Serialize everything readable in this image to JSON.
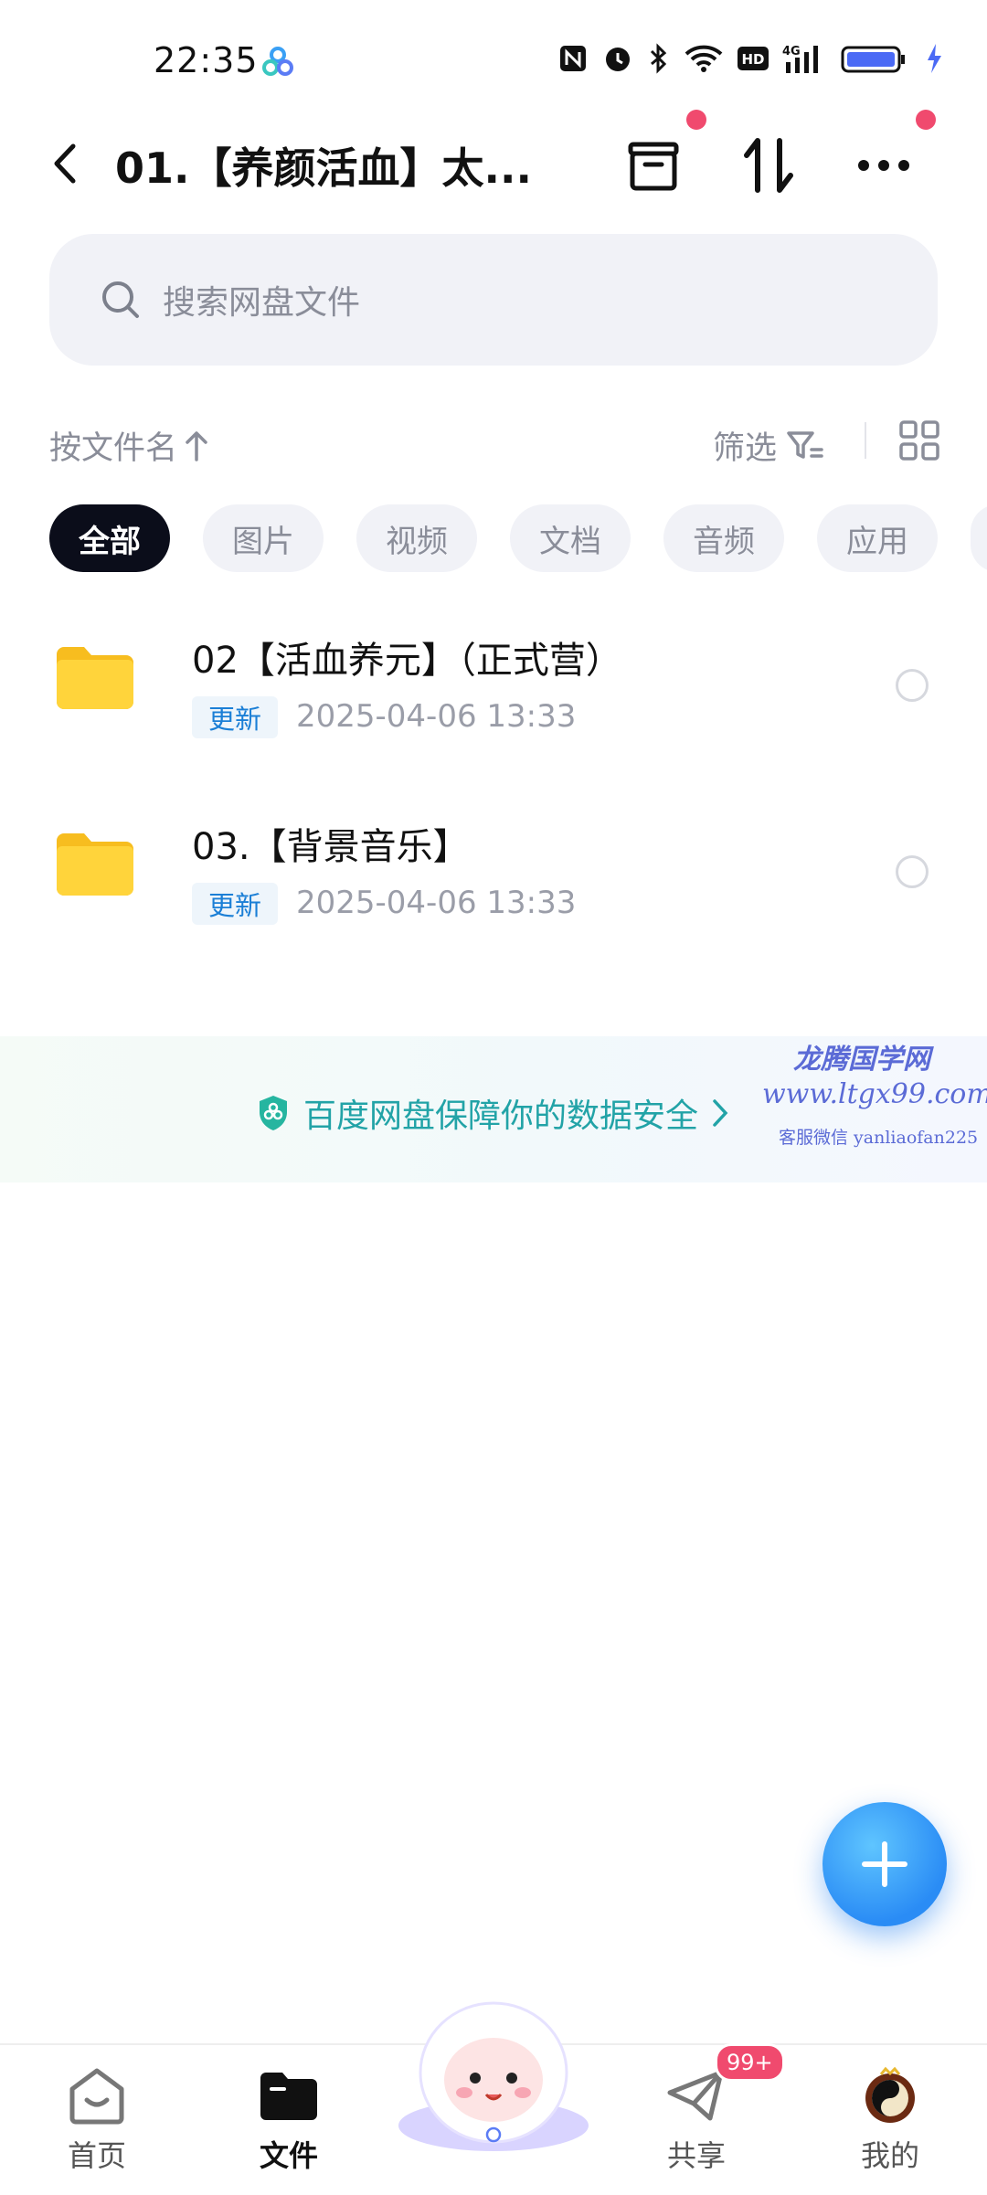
{
  "status_bar": {
    "time": "22:35"
  },
  "header": {
    "title": "01.【养颜活血】太..."
  },
  "search": {
    "placeholder": "搜索网盘文件"
  },
  "sort": {
    "label": "按文件名",
    "filter_label": "筛选"
  },
  "chips": [
    "全部",
    "图片",
    "视频",
    "文档",
    "音频",
    "应用"
  ],
  "files": [
    {
      "name": "02【活血养元】（正式营）",
      "badge": "更新",
      "date": "2025-04-06  13:33"
    },
    {
      "name": "03.【背景音乐】",
      "badge": "更新",
      "date": "2025-04-06  13:33"
    }
  ],
  "banner": {
    "text": "百度网盘保障你的数据安全"
  },
  "watermark": {
    "line1": "龙腾国学网",
    "line2": "www.ltgx99.com",
    "line3": "客服微信 yanliaofan225"
  },
  "nav": {
    "items": [
      "首页",
      "文件",
      "共享",
      "我的"
    ],
    "share_badge": "99+"
  },
  "colors": {
    "accent": "#2a8cf5",
    "badge_red": "#f04a6e",
    "chip_active": "#0b0d1a"
  }
}
